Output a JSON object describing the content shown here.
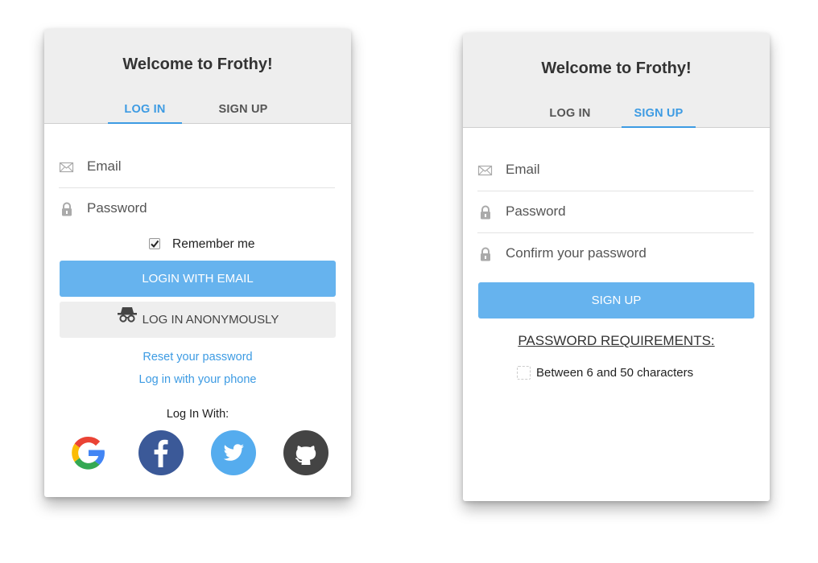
{
  "login_card": {
    "title": "Welcome to Frothy!",
    "tabs": [
      {
        "label": "LOG IN",
        "active": true
      },
      {
        "label": "SIGN UP",
        "active": false
      }
    ],
    "email_placeholder": "Email",
    "password_placeholder": "Password",
    "remember_me": {
      "label": "Remember me",
      "checked": true
    },
    "login_email_button": "LOGIN WITH EMAIL",
    "anonymous_button": {
      "label": "LOG IN ANONYMOUSLY",
      "icon": "spy-icon"
    },
    "reset_password_link": "Reset your password",
    "phone_login_link": "Log in with your phone",
    "social_heading": "Log In With:",
    "social_providers": [
      {
        "icon": "google-icon",
        "color": "#ffffff"
      },
      {
        "icon": "facebook-icon",
        "color": "#3b5998"
      },
      {
        "icon": "twitter-icon",
        "color": "#55acee"
      },
      {
        "icon": "github-icon",
        "color": "#444444"
      }
    ]
  },
  "signup_card": {
    "title": "Welcome to Frothy!",
    "tabs": [
      {
        "label": "LOG IN",
        "active": false
      },
      {
        "label": "SIGN UP",
        "active": true
      }
    ],
    "email_placeholder": "Email",
    "password_placeholder": "Password",
    "confirm_password_placeholder": "Confirm your password",
    "signup_button": "SIGN UP",
    "requirements_heading": "PASSWORD REQUIREMENTS:",
    "requirements": [
      {
        "label": "Between 6 and 50 characters",
        "met": false
      }
    ]
  },
  "colors": {
    "accent": "#3d9be3",
    "primary_button": "#66b3ee",
    "header_bg": "#eeeeee"
  }
}
